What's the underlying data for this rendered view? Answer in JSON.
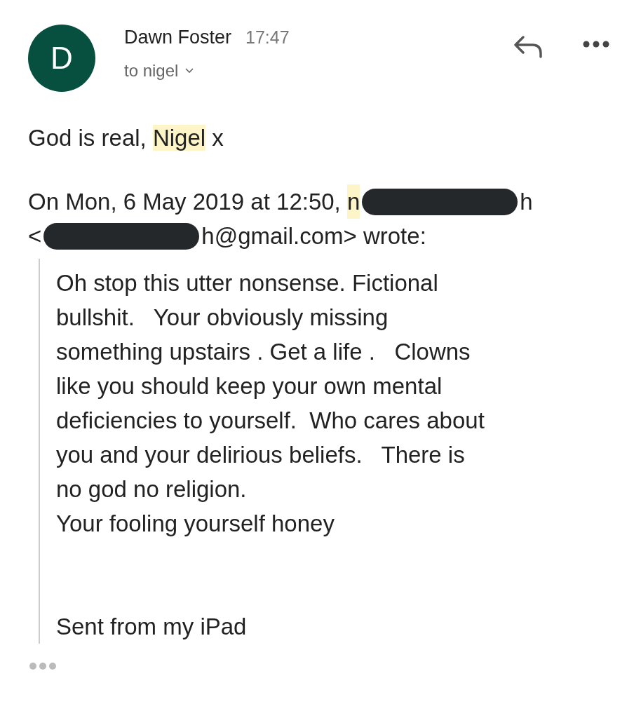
{
  "sender": {
    "initial": "D",
    "name": "Dawn Foster",
    "time": "17:47",
    "recipient": "to nigel"
  },
  "body": [
    {
      "text": "God is real, ",
      "highlighted": false
    },
    {
      "text": "Nigel",
      "highlighted": true
    },
    {
      "text": " x",
      "highlighted": false
    }
  ],
  "attribution": [
    [
      {
        "kind": "text",
        "text": "On Mon, 6 May 2019 at 12:50, ",
        "highlighted": false
      },
      {
        "kind": "text",
        "text": "n",
        "highlighted": true
      },
      {
        "kind": "redaction"
      },
      {
        "kind": "text",
        "text": "h",
        "highlighted": false
      }
    ],
    [
      {
        "kind": "text",
        "text": "<",
        "highlighted": false
      },
      {
        "kind": "redaction"
      },
      {
        "kind": "text",
        "text": "h@gmail.com> wrote:",
        "highlighted": false
      }
    ]
  ],
  "quoted_lines": [
    "Oh stop this utter nonsense. Fictional",
    "bullshit.   Your obviously missing",
    "something upstairs . Get a life .   Clowns",
    "like you should keep your own mental",
    "deficiencies to yourself.  Who cares about",
    "you and your delirious beliefs.   There is",
    "no god no religion.",
    "Your fooling yourself honey"
  ],
  "signature": "Sent from my iPad"
}
